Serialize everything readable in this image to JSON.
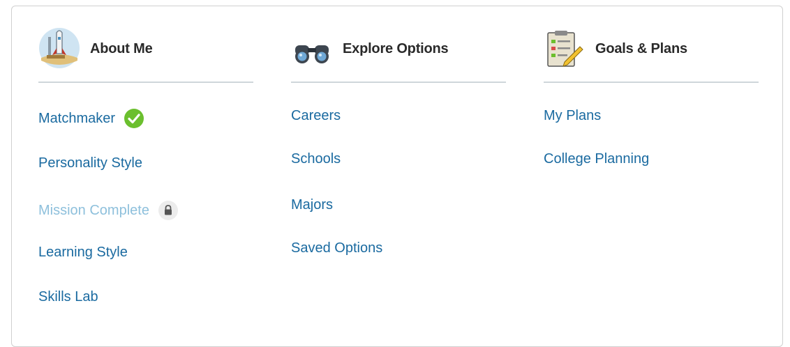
{
  "columns": [
    {
      "id": "about",
      "title": "About Me",
      "icon": "rocket-launch-icon",
      "items": [
        {
          "label": "Matchmaker",
          "status": "complete"
        },
        {
          "label": "Personality Style",
          "status": "available"
        },
        {
          "label": "Mission Complete",
          "status": "locked"
        },
        {
          "label": "Learning Style",
          "status": "available"
        },
        {
          "label": "Skills Lab",
          "status": "available"
        }
      ]
    },
    {
      "id": "explore",
      "title": "Explore Options",
      "icon": "binoculars-icon",
      "items": [
        {
          "label": "Careers"
        },
        {
          "label": "Schools"
        },
        {
          "label": "Majors"
        },
        {
          "label": "Saved Options"
        }
      ]
    },
    {
      "id": "goals",
      "title": "Goals & Plans",
      "icon": "clipboard-checklist-icon",
      "items": [
        {
          "label": "My Plans"
        },
        {
          "label": "College Planning"
        }
      ]
    }
  ],
  "colors": {
    "link": "#1a6aa0",
    "link_locked": "#8ec0dc",
    "check_green": "#6bbf2e",
    "divider": "#cfd6da"
  }
}
